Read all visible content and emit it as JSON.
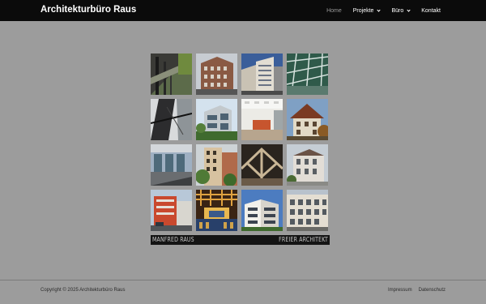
{
  "header": {
    "brand": "Architekturbüro Raus"
  },
  "nav": [
    {
      "label": "Home",
      "active": true,
      "dropdown": false
    },
    {
      "label": "Projekte",
      "active": false,
      "dropdown": true
    },
    {
      "label": "Büro",
      "active": false,
      "dropdown": true
    },
    {
      "label": "Kontakt",
      "active": false,
      "dropdown": false
    }
  ],
  "banner": {
    "left": "MANFRED RAUS",
    "right": "FREIER ARCHITEKT"
  },
  "footer": {
    "copyright": "Copyright © 2025 Architekturbüro Raus",
    "links": [
      "Impressum",
      "Datenschutz"
    ]
  }
}
